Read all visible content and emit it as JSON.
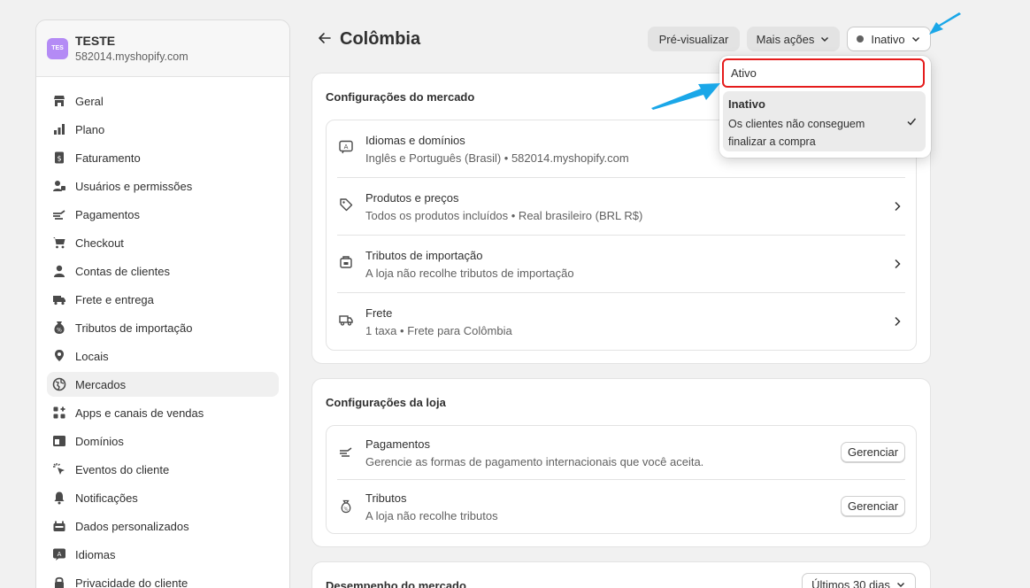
{
  "store": {
    "avatar": "TES",
    "name": "TESTE",
    "domain": "582014.myshopify.com"
  },
  "sidebar": {
    "items": [
      {
        "label": "Geral",
        "icon": "store-icon"
      },
      {
        "label": "Plano",
        "icon": "plan-icon"
      },
      {
        "label": "Faturamento",
        "icon": "billing-icon"
      },
      {
        "label": "Usuários e permissões",
        "icon": "users-icon"
      },
      {
        "label": "Pagamentos",
        "icon": "payments-icon"
      },
      {
        "label": "Checkout",
        "icon": "cart-icon"
      },
      {
        "label": "Contas de clientes",
        "icon": "person-icon"
      },
      {
        "label": "Frete e entrega",
        "icon": "truck-icon"
      },
      {
        "label": "Tributos de importação",
        "icon": "tax-bag-icon"
      },
      {
        "label": "Locais",
        "icon": "location-icon"
      },
      {
        "label": "Mercados",
        "icon": "globe-icon",
        "active": true
      },
      {
        "label": "Apps e canais de vendas",
        "icon": "apps-icon"
      },
      {
        "label": "Domínios",
        "icon": "domain-icon"
      },
      {
        "label": "Eventos do cliente",
        "icon": "cursor-click-icon"
      },
      {
        "label": "Notificações",
        "icon": "bell-icon"
      },
      {
        "label": "Dados personalizados",
        "icon": "data-icon"
      },
      {
        "label": "Idiomas",
        "icon": "language-icon"
      },
      {
        "label": "Privacidade do cliente",
        "icon": "lock-icon"
      }
    ]
  },
  "header": {
    "title": "Colômbia",
    "preview_label": "Pré-visualizar",
    "more_label": "Mais ações",
    "status_label": "Inativo"
  },
  "dropdown": {
    "option_active": "Ativo",
    "option_inactive_title": "Inativo",
    "option_inactive_desc": "Os clientes não conseguem finalizar a compra"
  },
  "market_settings": {
    "title": "Configurações do mercado",
    "rows": [
      {
        "title": "Idiomas e domínios",
        "sub": "Inglês e Português (Brasil) • 582014.myshopify.com",
        "icon": "language-icon"
      },
      {
        "title": "Produtos e preços",
        "sub": "Todos os produtos incluídos • Real brasileiro (BRL R$)",
        "icon": "tag-icon"
      },
      {
        "title": "Tributos de importação",
        "sub": "A loja não recolhe tributos de importação",
        "icon": "import-box-icon"
      },
      {
        "title": "Frete",
        "sub": "1 taxa • Frete para Colômbia",
        "icon": "truck-icon"
      }
    ]
  },
  "store_settings": {
    "title": "Configurações da loja",
    "manage_label": "Gerenciar",
    "rows": [
      {
        "title": "Pagamentos",
        "sub": "Gerencie as formas de pagamento internacionais que você aceita.",
        "icon": "payments-icon"
      },
      {
        "title": "Tributos",
        "sub": "A loja não recolhe tributos",
        "icon": "tax-bag-icon"
      }
    ]
  },
  "performance": {
    "title": "Desempenho do mercado",
    "period_label": "Últimos 30 dias"
  },
  "colors": {
    "annotation_arrow": "#1aa7e8",
    "highlight_box": "#e51c1c"
  }
}
